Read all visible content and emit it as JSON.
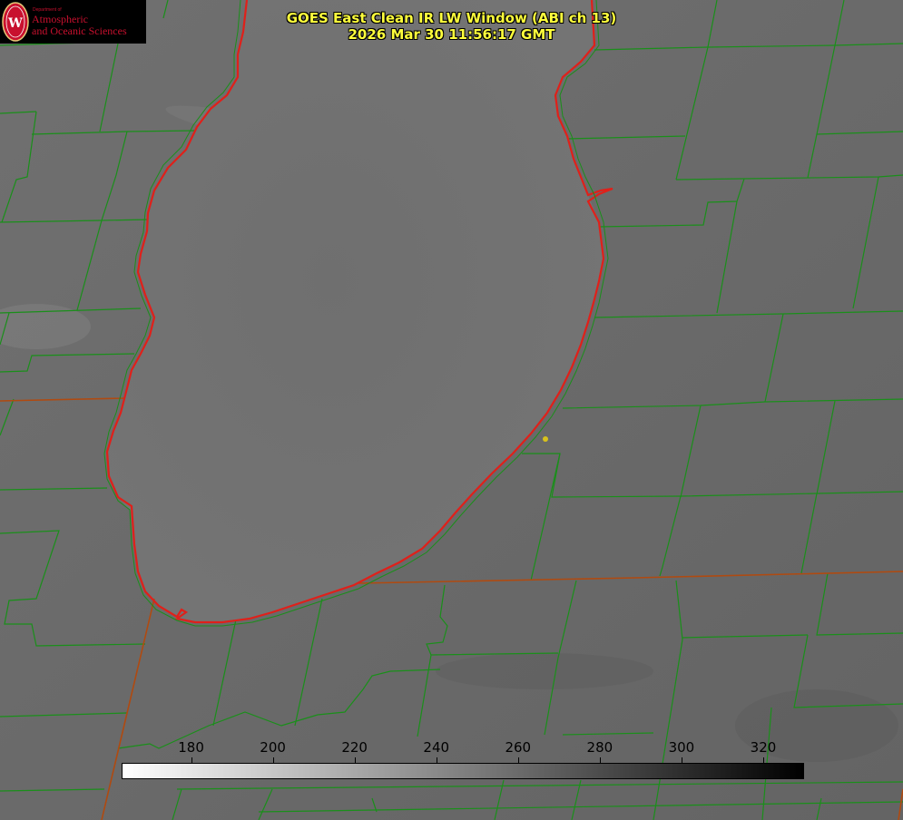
{
  "title": {
    "line1": "GOES East Clean IR LW Window (ABI ch 13)",
    "line2": "2026 Mar 30 11:56:17 GMT"
  },
  "logo": {
    "department": "Department of",
    "name_line1": "Atmospheric",
    "name_line2": "and Oceanic Sciences",
    "shield_letter": "W"
  },
  "colorbar": {
    "min_value": 163,
    "max_value": 330,
    "gradient_start": "#ffffff",
    "gradient_end": "#000000",
    "tick_labels": [
      "180",
      "200",
      "220",
      "240",
      "260",
      "280",
      "300",
      "320"
    ],
    "tick_values": [
      180,
      200,
      220,
      240,
      260,
      280,
      300,
      320
    ]
  },
  "colors": {
    "background_gray": "#6a6a6a",
    "lake_gray": "#737373",
    "county_lines": "#1a8f1a",
    "state_lines": "#b04a10",
    "shoreline": "#e0201a",
    "title_text": "#ffff3c",
    "marker": "#d8c21c"
  }
}
